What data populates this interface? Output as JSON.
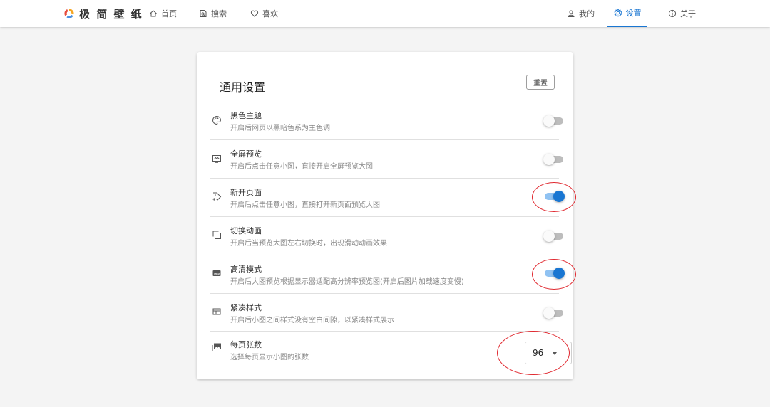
{
  "header": {
    "brand": "极 简 壁 纸",
    "nav_left": [
      {
        "label": "首页",
        "icon": "home-icon"
      },
      {
        "label": "搜索",
        "icon": "search-icon"
      },
      {
        "label": "喜欢",
        "icon": "heart-icon"
      }
    ],
    "nav_right": [
      {
        "label": "我的",
        "icon": "user-icon"
      },
      {
        "label": "设置",
        "icon": "gear-icon",
        "active": true
      },
      {
        "label": "关于",
        "icon": "info-icon"
      }
    ],
    "accent_color": "#1976d2"
  },
  "settings": {
    "title": "通用设置",
    "reset_label": "重置",
    "items": [
      {
        "title": "黑色主题",
        "desc": "开启后网页以黑暗色系为主色调",
        "icon": "palette-icon",
        "enabled": false
      },
      {
        "title": "全屏预览",
        "desc": "开启后点击任意小图，直接开启全屏预览大图",
        "icon": "fullscreen-preview-icon",
        "enabled": false
      },
      {
        "title": "新开页面",
        "desc": "开启后点击任意小图，直接打开新页面预览大图",
        "icon": "new-tab-icon",
        "enabled": true
      },
      {
        "title": "切换动画",
        "desc": "开启后当预览大图左右切换时，出现滑动动画效果",
        "icon": "copy-icon",
        "enabled": false
      },
      {
        "title": "高清模式",
        "desc": "开启后大图预览根据显示器适配高分辨率预览图(开启后图片加载速度变慢)",
        "icon": "hd-icon",
        "enabled": true
      },
      {
        "title": "紧凑样式",
        "desc": "开启后小图之间样式没有空白间隙，以紧凑样式展示",
        "icon": "layout-icon",
        "enabled": false
      },
      {
        "title": "每页张数",
        "desc": "选择每页显示小图的张数",
        "icon": "image-icon",
        "value": "96"
      }
    ]
  }
}
